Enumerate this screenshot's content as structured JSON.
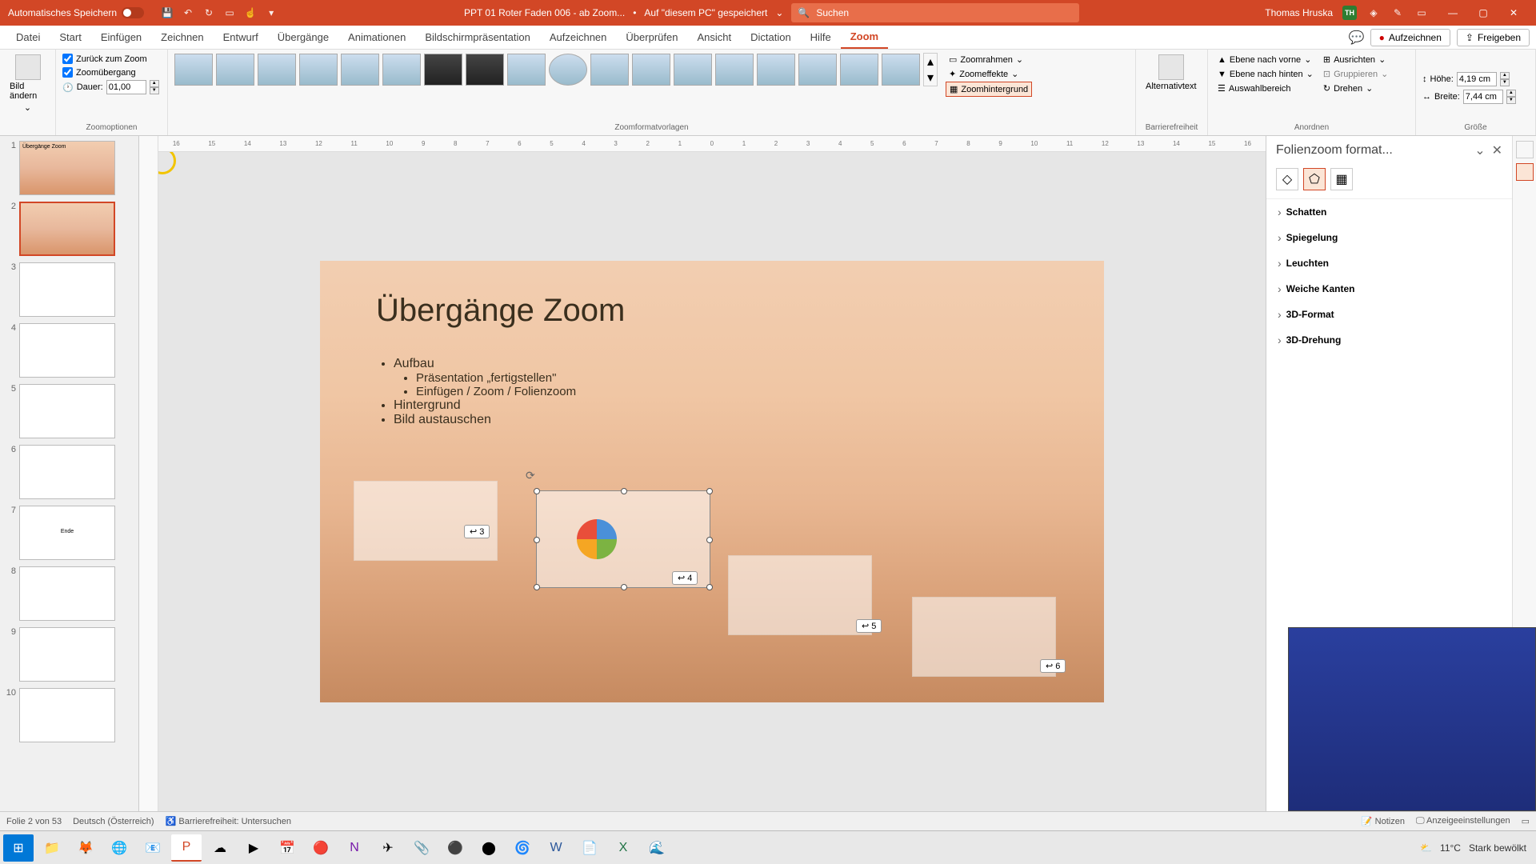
{
  "titlebar": {
    "autosave_label": "Automatisches Speichern",
    "filename": "PPT 01 Roter Faden 006 - ab Zoom...",
    "saved_location": "Auf \"diesem PC\" gespeichert",
    "search_placeholder": "Suchen",
    "username": "Thomas Hruska",
    "user_initials": "TH"
  },
  "tabs": {
    "items": [
      "Datei",
      "Start",
      "Einfügen",
      "Zeichnen",
      "Entwurf",
      "Übergänge",
      "Animationen",
      "Bildschirmpräsentation",
      "Aufzeichnen",
      "Überprüfen",
      "Ansicht",
      "Dictation",
      "Hilfe",
      "Zoom"
    ],
    "active": "Zoom",
    "record": "Aufzeichnen",
    "share": "Freigeben"
  },
  "ribbon": {
    "changeimage": "Bild ändern",
    "return_to_zoom": "Zurück zum Zoom",
    "zoom_transition": "Zoomübergang",
    "duration_label": "Dauer:",
    "duration_value": "01,00",
    "group_zoomoptions": "Zoomoptionen",
    "group_zoomstyles": "Zoomformatvorlagen",
    "zoom_frame": "Zoomrahmen",
    "zoom_effects": "Zoomeffekte",
    "zoom_background": "Zoomhintergrund",
    "alttext": "Alternativtext",
    "group_accessibility": "Barrierefreiheit",
    "bring_forward": "Ebene nach vorne",
    "send_backward": "Ebene nach hinten",
    "selection_pane": "Auswahlbereich",
    "align": "Ausrichten",
    "group": "Gruppieren",
    "rotate": "Drehen",
    "group_arrange": "Anordnen",
    "height_label": "Höhe:",
    "height_value": "4,19 cm",
    "width_label": "Breite:",
    "width_value": "7,44 cm",
    "group_size": "Größe"
  },
  "rulerTicks": [
    "16",
    "15",
    "14",
    "13",
    "12",
    "11",
    "10",
    "9",
    "8",
    "7",
    "6",
    "5",
    "4",
    "3",
    "2",
    "1",
    "0",
    "1",
    "2",
    "3",
    "4",
    "5",
    "6",
    "7",
    "8",
    "9",
    "10",
    "11",
    "12",
    "13",
    "14",
    "15",
    "16"
  ],
  "thumbnails": {
    "items": [
      {
        "n": "1",
        "title": "Übergänge Zoom"
      },
      {
        "n": "2",
        "title": ""
      },
      {
        "n": "3",
        "title": ""
      },
      {
        "n": "4",
        "title": ""
      },
      {
        "n": "5",
        "title": ""
      },
      {
        "n": "6",
        "title": ""
      },
      {
        "n": "7",
        "title": "Ende"
      },
      {
        "n": "8",
        "title": ""
      },
      {
        "n": "9",
        "title": ""
      },
      {
        "n": "10",
        "title": ""
      }
    ],
    "selected": 2
  },
  "slide": {
    "title": "Übergänge Zoom",
    "bullets": {
      "l1a": "Aufbau",
      "l2a": "Präsentation „fertigstellen\"",
      "l2b": "Einfügen / Zoom / Folienzoom",
      "l1b": "Hintergrund",
      "l1c": "Bild austauschen"
    },
    "return3": "3",
    "return4": "4",
    "return5": "5",
    "return6": "6"
  },
  "pane": {
    "title": "Folienzoom format...",
    "sections": [
      "Schatten",
      "Spiegelung",
      "Leuchten",
      "Weiche Kanten",
      "3D-Format",
      "3D-Drehung"
    ]
  },
  "status": {
    "slide_info": "Folie 2 von 53",
    "language": "Deutsch (Österreich)",
    "accessibility": "Barrierefreiheit: Untersuchen",
    "notes": "Notizen",
    "display": "Anzeigeeinstellungen"
  },
  "taskbar": {
    "weather_temp": "11°C",
    "weather_text": "Stark bewölkt"
  }
}
